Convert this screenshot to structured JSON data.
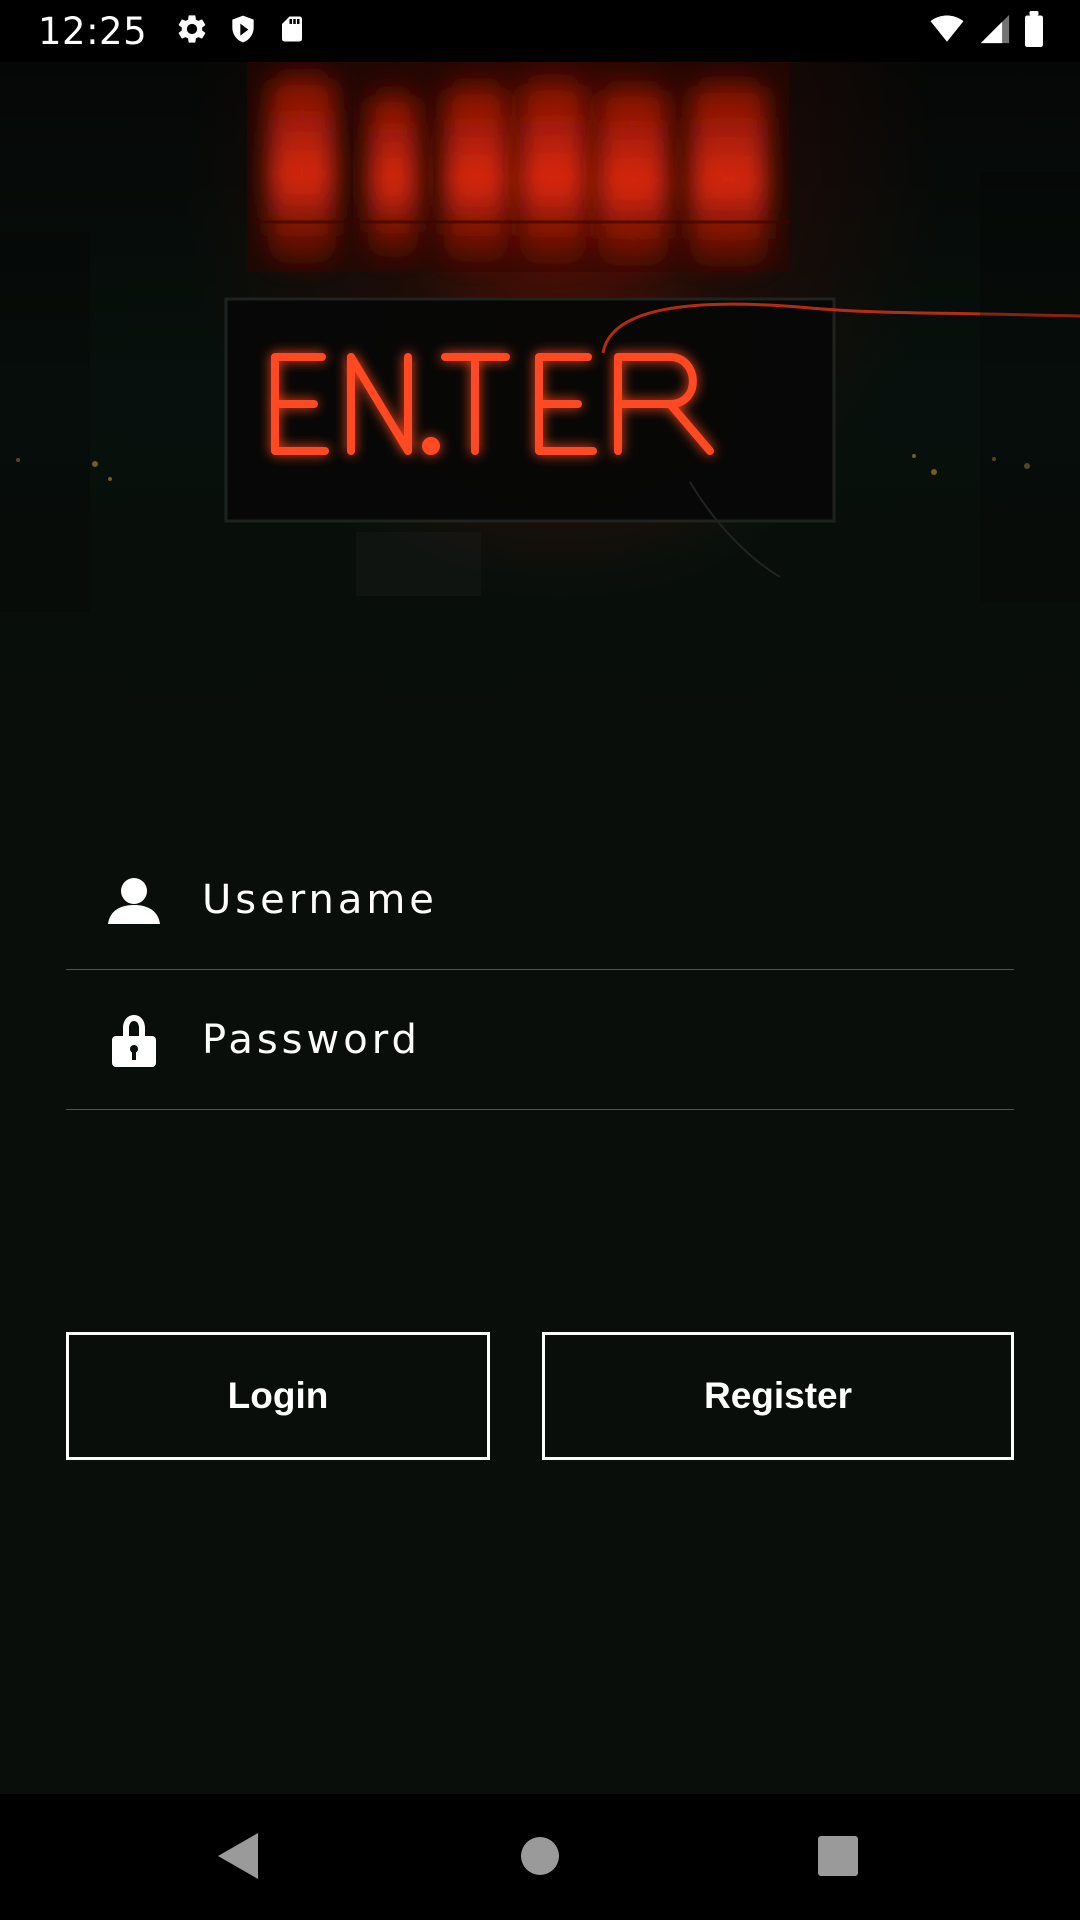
{
  "status_bar": {
    "time": "12:25",
    "left_icons": [
      "settings-icon",
      "shield-icon",
      "sd-card-icon"
    ],
    "right_icons": [
      "wifi-icon",
      "signal-icon",
      "battery-icon"
    ]
  },
  "hero": {
    "description": "ENTER"
  },
  "form": {
    "username": {
      "placeholder": "Username",
      "value": "",
      "icon": "user-icon"
    },
    "password": {
      "placeholder": "Password",
      "value": "",
      "icon": "lock-icon"
    }
  },
  "buttons": {
    "login_label": "Login",
    "register_label": "Register"
  },
  "nav_bar": {
    "items": [
      "back-icon",
      "home-icon",
      "recents-icon"
    ]
  },
  "colors": {
    "background": "#090e0a",
    "status_bar": "#000000",
    "text": "#ffffff",
    "divider": "#4f5450",
    "neon": "#ff4a22"
  }
}
